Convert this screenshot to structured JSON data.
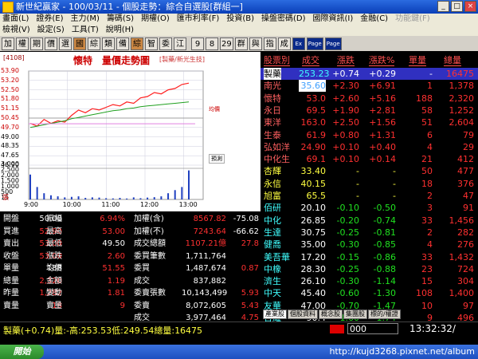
{
  "window": {
    "title": "新世紀贏家 - 100/03/11 - 個股走勢：綜合自選股[群組一]",
    "buttons": {
      "minimize": "_",
      "maximize": "□",
      "close": "×"
    }
  },
  "menu": {
    "row1": [
      "畫面(L)",
      "證券(E)",
      "主力(M)",
      "籌碼(S)",
      "期權(O)",
      "匯市利率(F)",
      "投資(B)",
      "操盤密碼(D)",
      "國際資訊(I)",
      "金融(C)",
      "功能鍵(F)"
    ],
    "row1_dim": [
      "功能鍵(F)"
    ],
    "row2": [
      "檢視(V)",
      "設定(S)",
      "工具(T)",
      "說明(H)"
    ]
  },
  "toolbar": {
    "items": [
      "加",
      "權",
      "期",
      "價",
      "選",
      "國",
      "綜",
      "類",
      "備",
      "綜",
      "智",
      "委",
      "江",
      "9",
      "8",
      "29",
      "群",
      "與",
      "指",
      "成",
      "Ex",
      "Page",
      "Page"
    ]
  },
  "chart": {
    "code": "[4108]",
    "title": "懷特　量價走勢圖",
    "subtitle": "[製藥/新光生技]",
    "price_ticks": [
      "53.90",
      "53.20",
      "52.50",
      "51.80",
      "51.15",
      "50.45",
      "49.70",
      "49.00",
      "48.35",
      "47.65",
      "46.90"
    ],
    "vol_ticks": [
      "3,000",
      "2,500",
      "2,000",
      "1,500",
      "1,000",
      "500",
      "15"
    ],
    "vol_unit": "張",
    "time_labels": [
      "9:00",
      "10:00",
      "11:00",
      "12:00",
      "13:00"
    ],
    "legend1": "均價",
    "legend2": "預測"
  },
  "chart_data": {
    "type": "line",
    "series": [
      {
        "values": [
          50.0,
          49.8,
          50.3,
          50.0,
          50.2,
          50.1,
          50.6,
          51.0,
          50.8,
          51.1,
          51.0,
          51.2,
          51.4,
          51.3,
          51.6,
          51.5,
          51.9,
          52.0,
          52.3,
          52.2,
          52.5,
          52.6,
          52.9,
          53.0
        ]
      },
      {
        "values": [
          49.7,
          49.8,
          49.9,
          50.0,
          50.1,
          50.2,
          50.35,
          50.45,
          50.55,
          50.65,
          50.75,
          50.85,
          50.95,
          51.0,
          51.1,
          51.15,
          51.25,
          51.3,
          51.35,
          51.4,
          51.45,
          51.5,
          51.55,
          51.6
        ]
      }
    ],
    "volume": [
      2400,
      1200,
      600,
      400,
      300,
      200,
      250,
      300,
      150,
      200,
      180,
      120,
      100,
      150,
      90,
      200,
      120,
      180,
      220,
      300,
      600,
      900,
      1200,
      2800
    ],
    "ylim": [
      46.9,
      53.9
    ],
    "vol_ylim": [
      0,
      3000
    ]
  },
  "stats": [
    {
      "l": "開盤",
      "v": "50.00",
      "vc": "lab",
      "l2": "振幅",
      "v2": "6.94%",
      "v2c": "red",
      "l3": "加權(含)",
      "v3": "8567.82",
      "v3c": "red",
      "v4": "-75.08",
      "v4c": "lab"
    },
    {
      "l": "買進",
      "v": "52.90",
      "vc": "red",
      "l2": "最高",
      "v2": "53.00",
      "v2c": "red",
      "l3": "加權(不)",
      "v3": "7243.64",
      "v3c": "red",
      "v4": "-66.62",
      "v4c": "lab"
    },
    {
      "l": "賣出",
      "v": "53.00",
      "vc": "red",
      "l2": "最低",
      "v2": "49.50",
      "v2c": "lab",
      "l3": "成交總額",
      "v3": "1107.21億",
      "v3c": "red",
      "v4": "27.8",
      "v4c": "red"
    },
    {
      "l": "收盤",
      "v": "53.00",
      "vc": "red",
      "l2": "漲跌",
      "v2": "2.60",
      "v2c": "red",
      "l3": "委買筆數",
      "v3": "1,711,764",
      "v3c": "lab",
      "v4": "",
      "v4c": "lab"
    },
    {
      "l": "單量",
      "v": "188",
      "vc": "lab",
      "l2": "均價",
      "v2": "51.55",
      "v2c": "red",
      "l3": "委買",
      "v3": "1,487,674",
      "v3c": "lab",
      "v4": "0.87",
      "v4c": "red"
    },
    {
      "l": "總量",
      "v": "2,320",
      "vc": "red",
      "l2": "金額",
      "v2": "1.19",
      "v2c": "red",
      "l3": "成交",
      "v3": "837,882",
      "v3c": "lab",
      "v4": "",
      "v4c": "lab"
    },
    {
      "l": "昨量",
      "v": "1,282",
      "vc": "red",
      "l2": "變動",
      "v2": "1.81",
      "v2c": "red",
      "l3": "委賣張數",
      "v3": "10,143,499",
      "v3c": "lab",
      "v4": "5.93",
      "v4c": "red"
    },
    {
      "l": "賣量",
      "v": "18",
      "vc": "red",
      "l2": "賣量",
      "v2": "9",
      "v2c": "red",
      "l3": "委賣",
      "v3": "8,072,605",
      "v3c": "lab",
      "v4": "5.43",
      "v4c": "red"
    },
    {
      "l": "",
      "v": "",
      "vc": "lab",
      "l2": "",
      "v2": "",
      "v2c": "lab",
      "l3": "成交",
      "v3": "3,977,464",
      "v3c": "lab",
      "v4": "4.75",
      "v4c": "red"
    }
  ],
  "quote": {
    "headers": [
      "股票別",
      "成交",
      "漲跌",
      "漲跌%",
      "單量",
      "總量"
    ],
    "rows": [
      {
        "name": "製藥",
        "price": "253.23",
        "chg": "+0.74",
        "pct": "+0.29",
        "vol": "-",
        "total": "16475",
        "hl": true,
        "pc": "red"
      },
      {
        "name": "南光",
        "price": "35.60",
        "chg": "+2.30",
        "pct": "+6.91",
        "vol": "1",
        "total": "1,378",
        "hl2": true,
        "pc": "red"
      },
      {
        "name": "懷特",
        "price": "53.0",
        "chg": "+2.60",
        "pct": "+5.16",
        "vol": "188",
        "total": "2,320",
        "pc": "red"
      },
      {
        "name": "永日",
        "price": "69.5",
        "chg": "+1.90",
        "pct": "+2.81",
        "vol": "58",
        "total": "1,252",
        "pc": "red"
      },
      {
        "name": "東洋",
        "price": "163.0",
        "chg": "+2.50",
        "pct": "+1.56",
        "vol": "51",
        "total": "2,604",
        "pc": "red"
      },
      {
        "name": "生泰",
        "price": "61.9",
        "chg": "+0.80",
        "pct": "+1.31",
        "vol": "6",
        "total": "79",
        "pc": "red"
      },
      {
        "name": "弘如洋",
        "price": "24.90",
        "chg": "+0.10",
        "pct": "+0.40",
        "vol": "4",
        "total": "29",
        "pc": "red"
      },
      {
        "name": "中化生",
        "price": "69.1",
        "chg": "+0.10",
        "pct": "+0.14",
        "vol": "21",
        "total": "412",
        "pc": "red"
      },
      {
        "name": "杏輝",
        "price": "33.40",
        "chg": "-",
        "pct": "-",
        "vol": "50",
        "total": "477",
        "pc": "yel"
      },
      {
        "name": "永信",
        "price": "40.15",
        "chg": "-",
        "pct": "-",
        "vol": "18",
        "total": "376",
        "pc": "yel"
      },
      {
        "name": "旭富",
        "price": "65.5",
        "chg": "-",
        "pct": "-",
        "vol": "2",
        "total": "47",
        "pc": "yel"
      },
      {
        "name": "佰研",
        "price": "20.10",
        "chg": "-0.10",
        "pct": "-0.50",
        "vol": "3",
        "total": "91",
        "pc": "lab"
      },
      {
        "name": "中化",
        "price": "26.85",
        "chg": "-0.20",
        "pct": "-0.74",
        "vol": "33",
        "total": "1,456",
        "pc": "lab"
      },
      {
        "name": "生達",
        "price": "30.75",
        "chg": "-0.25",
        "pct": "-0.81",
        "vol": "2",
        "total": "282",
        "pc": "lab"
      },
      {
        "name": "健喬",
        "price": "35.00",
        "chg": "-0.30",
        "pct": "-0.85",
        "vol": "4",
        "total": "276",
        "pc": "lab"
      },
      {
        "name": "美吾華",
        "price": "17.20",
        "chg": "-0.15",
        "pct": "-0.86",
        "vol": "33",
        "total": "1,432",
        "pc": "lab"
      },
      {
        "name": "中橡",
        "price": "28.30",
        "chg": "-0.25",
        "pct": "-0.88",
        "vol": "23",
        "total": "724",
        "pc": "lab"
      },
      {
        "name": "濟生",
        "price": "26.10",
        "chg": "-0.30",
        "pct": "-1.14",
        "vol": "15",
        "total": "304",
        "pc": "lab"
      },
      {
        "name": "中天",
        "price": "45.40",
        "chg": "-0.60",
        "pct": "-1.30",
        "vol": "108",
        "total": "1,400",
        "pc": "lab"
      },
      {
        "name": "友華",
        "price": "47.00",
        "chg": "-0.70",
        "pct": "-1.47",
        "vol": "10",
        "total": "97",
        "pc": "lab"
      },
      {
        "name": "台耀",
        "price": "90.4",
        "chg": "-1.60",
        "pct": "-1.74",
        "vol": "9",
        "total": "496",
        "pc": "lab"
      }
    ]
  },
  "tabs": [
    "產業股",
    "個股資料",
    "概念股",
    "集團股",
    "標的/權證"
  ],
  "status": {
    "text": "製藥(+0.74)量:-高:253.53低:249.54總量:16475",
    "code": "000",
    "clock": "13:32:32/"
  },
  "taskbar": {
    "start": "開始",
    "watermark": "http://kujd3268.pixnet.net/album"
  }
}
